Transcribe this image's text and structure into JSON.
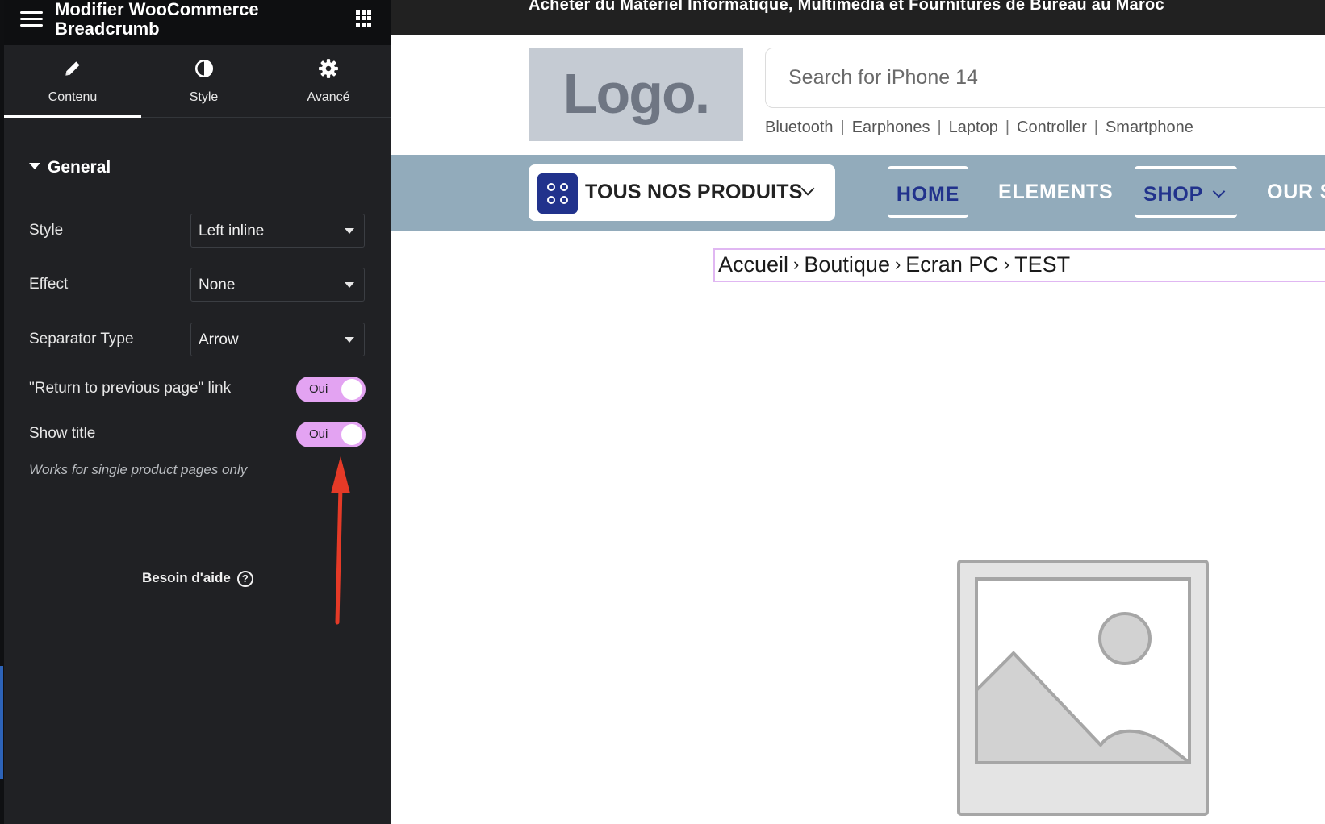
{
  "editor": {
    "title": "Modifier WooCommerce Breadcrumb",
    "tabs": [
      {
        "label": "Contenu",
        "icon": "pencil-icon"
      },
      {
        "label": "Style",
        "icon": "contrast-icon"
      },
      {
        "label": "Avancé",
        "icon": "gear-icon"
      }
    ],
    "section_title": "General",
    "fields": [
      {
        "label": "Style",
        "value": "Left inline"
      },
      {
        "label": "Effect",
        "value": "None"
      },
      {
        "label": "Separator Type",
        "value": "Arrow"
      }
    ],
    "toggles": [
      {
        "label": "\"Return to previous page\" link",
        "value": "Oui"
      },
      {
        "label": "Show title",
        "value": "Oui"
      }
    ],
    "hint": "Works for single product pages only",
    "help_label": "Besoin d'aide",
    "toggle_color": "#e3a3f2"
  },
  "preview": {
    "topbar_text": "Acheter du Matériel Informatique, Multimédia et Fournitures de Bureau au Maroc",
    "logo_text": "Logo.",
    "search_placeholder": "Search for iPhone 14",
    "quick_links": [
      "Bluetooth",
      "Earphones",
      "Laptop",
      "Controller",
      "Smartphone"
    ],
    "all_products_label": "TOUS NOS PRODUITS",
    "nav": {
      "home": "HOME",
      "elements": "ELEMENTS",
      "shop": "SHOP",
      "ours": "OUR S"
    },
    "breadcrumb": [
      "Accueil",
      "Boutique",
      "Ecran PC",
      "TEST"
    ],
    "colors": {
      "brand": "#21328c",
      "navbar": "#92abbb",
      "annotation_arrow": "#e53a27"
    }
  }
}
